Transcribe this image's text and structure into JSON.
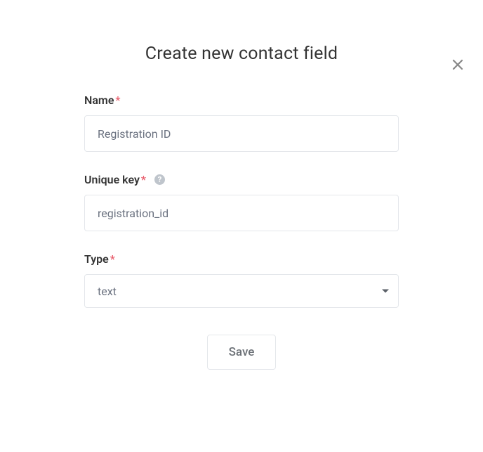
{
  "dialog": {
    "title": "Create new contact field"
  },
  "fields": {
    "name": {
      "label": "Name",
      "value": "Registration ID"
    },
    "unique_key": {
      "label": "Unique key",
      "value": "registration_id"
    },
    "type": {
      "label": "Type",
      "value": "text"
    }
  },
  "buttons": {
    "save": "Save"
  },
  "required_marker": "*",
  "help_marker": "?"
}
